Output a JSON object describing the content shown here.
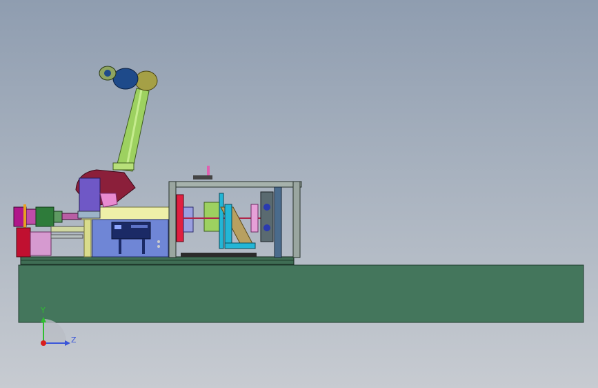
{
  "view": {
    "background_top": "#8f9db0",
    "background_bottom": "#c7cbd1"
  },
  "model": {
    "base_color": "#44765c",
    "frame_color": "#1f3c2f",
    "arm_color": "#9dd160",
    "arm_joint_color": "#1e4a8a",
    "arm_shoulder_color": "#8b1f3a",
    "accent_magenta": "#b0168a",
    "accent_cyan": "#23b6d6",
    "accent_blue_panel": "#6f86d6"
  },
  "triad": {
    "axis_y_label": "Y",
    "axis_z_label": "Z",
    "y_color": "#2fbf2f",
    "z_color": "#3a55d8",
    "origin_color": "#d91e1e"
  }
}
